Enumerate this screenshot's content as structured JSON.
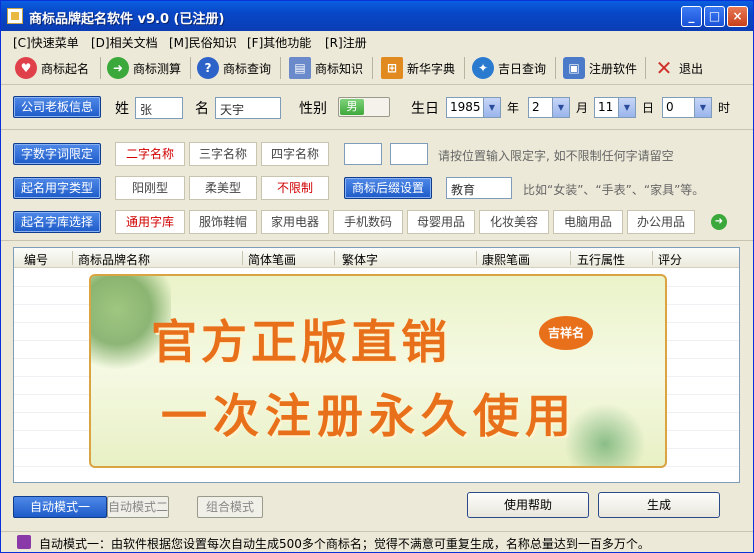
{
  "window": {
    "title": "商标品牌起名软件 v9.0 (已注册)",
    "minimize": "_",
    "maximize": "□",
    "close": "×"
  },
  "menu": [
    {
      "label": "[C]快速菜单"
    },
    {
      "label": "[D]相关文档"
    },
    {
      "label": "[M]民俗知识"
    },
    {
      "label": "[F]其他功能"
    },
    {
      "label": "[R]注册"
    }
  ],
  "toolbar": [
    {
      "label": "商标起名",
      "icon": "heart-icon",
      "color": "#e0404a"
    },
    {
      "label": "商标测算",
      "icon": "arrow-right-icon",
      "color": "#3aa83a"
    },
    {
      "label": "商标查询",
      "icon": "help-icon",
      "color": "#2d63c8"
    },
    {
      "label": "商标知识",
      "icon": "document-icon",
      "color": "#6a8acb"
    },
    {
      "label": "新华字典",
      "icon": "windows-flag-icon",
      "color": "#e08a20"
    },
    {
      "label": "吉日查询",
      "icon": "compass-icon",
      "color": "#2a7ad0"
    },
    {
      "label": "注册软件",
      "icon": "computer-icon",
      "color": "#4a7ac8"
    },
    {
      "label": "退出",
      "icon": "close-x-icon",
      "color": "#d0302a"
    }
  ],
  "owner": {
    "button": "公司老板信息",
    "surname_label": "姓",
    "surname_value": "张",
    "name_label": "名",
    "name_value": "天宇",
    "gender_label": "性别",
    "gender_value": "男",
    "birth_label": "生日",
    "year_value": "1985",
    "year_unit": "年",
    "month_value": "2",
    "month_unit": "月",
    "day_value": "11",
    "day_unit": "日",
    "hour_value": "0",
    "hour_unit": "时"
  },
  "length_limit": {
    "button": "字数字词限定",
    "options": [
      "二字名称",
      "三字名称",
      "四字名称"
    ],
    "hint": "请按位置输入限定字, 如不限制任何字请留空"
  },
  "char_type": {
    "button": "起名用字类型",
    "options": [
      "阳刚型",
      "柔美型",
      "不限制"
    ],
    "suffix_button": "商标后缀设置",
    "suffix_value": "教育",
    "hint": "比如“女装”、“手表”、“家具”等。"
  },
  "library": {
    "button": "起名字库选择",
    "options": [
      "通用字库",
      "服饰鞋帽",
      "家用电器",
      "手机数码",
      "母婴用品",
      "化妆美容",
      "电脑用品",
      "办公用品"
    ]
  },
  "table": {
    "columns": [
      "编号",
      "商标品牌名称",
      "简体笔画",
      "繁体字",
      "康熙笔画",
      "五行属性",
      "评分"
    ]
  },
  "banner": {
    "line1": "官方正版直销",
    "line2": "一次注册永久使用",
    "badge": "吉祥名"
  },
  "modes": [
    "自动模式一",
    "自动模式二",
    "组合模式"
  ],
  "actions": {
    "help": "使用帮助",
    "generate": "生成"
  },
  "status": "自动模式一：由软件根据您设置每次自动生成500多个商标名；觉得不满意可重复生成，名称总量达到一百多万个。"
}
